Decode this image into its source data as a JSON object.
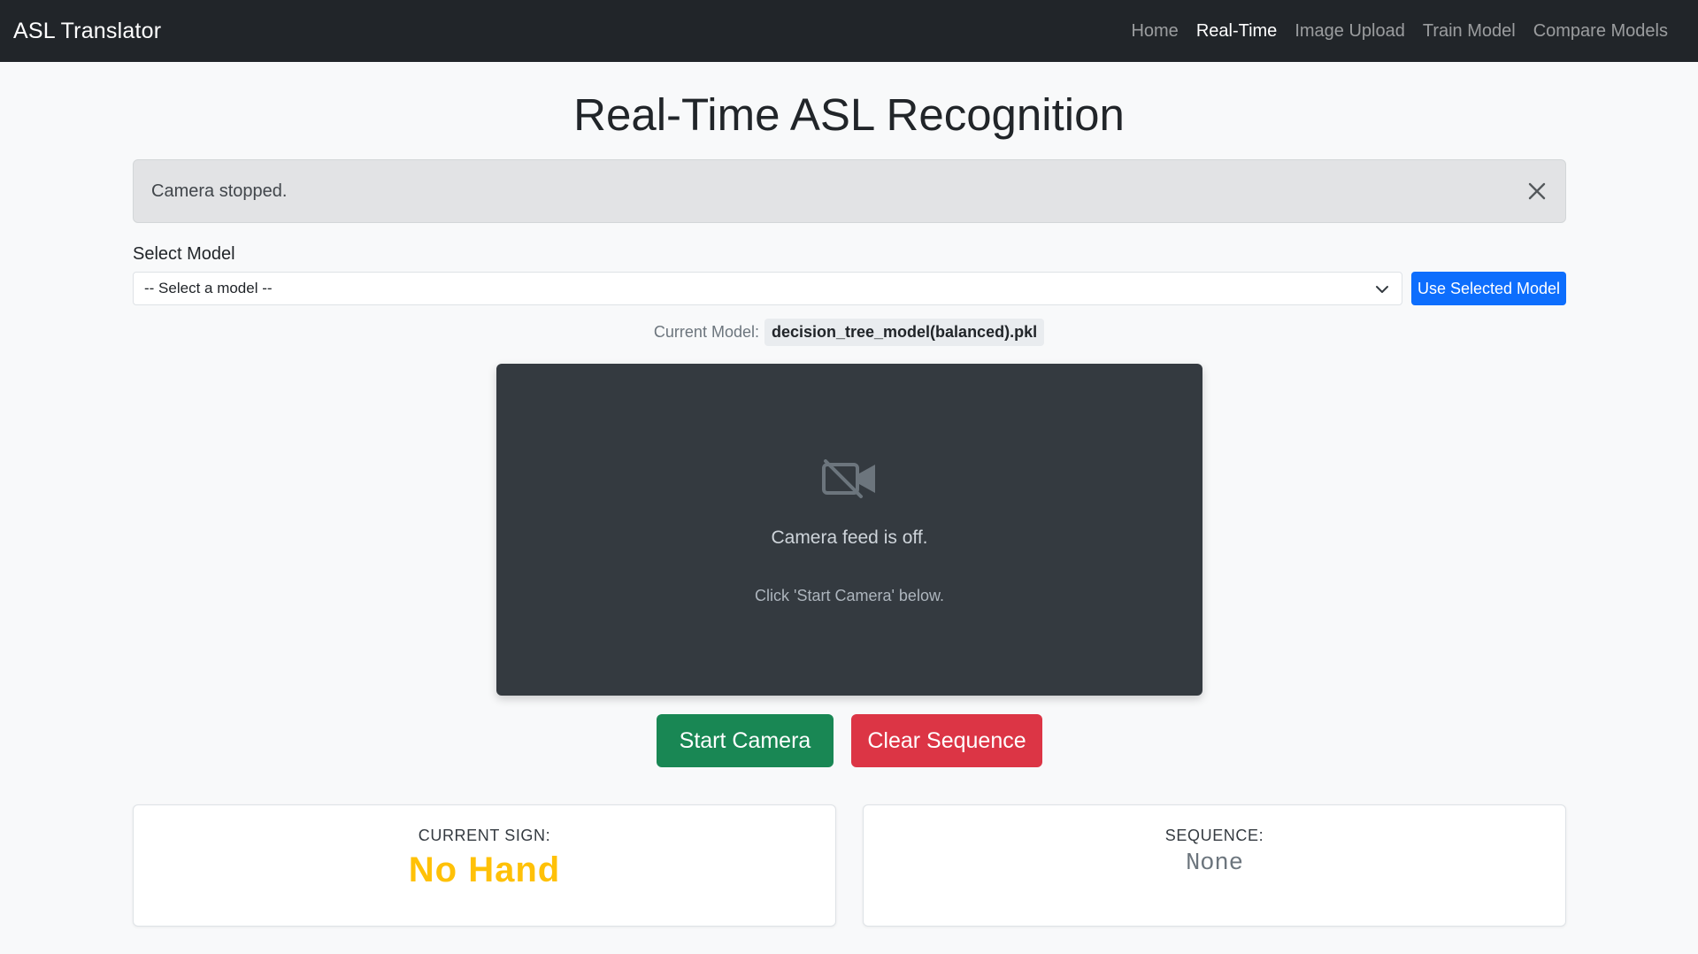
{
  "navbar": {
    "brand": "ASL Translator",
    "links": [
      {
        "label": "Home",
        "active": false
      },
      {
        "label": "Real-Time",
        "active": true
      },
      {
        "label": "Image Upload",
        "active": false
      },
      {
        "label": "Train Model",
        "active": false
      },
      {
        "label": "Compare Models",
        "active": false
      }
    ]
  },
  "page": {
    "title": "Real-Time ASL Recognition"
  },
  "alert": {
    "message": "Camera stopped.",
    "close_icon": "close-icon"
  },
  "model": {
    "select_label": "Select Model",
    "selected_option": "-- Select a model --",
    "use_button": "Use Selected Model",
    "current_label": "Current Model:",
    "current_value": "decision_tree_model(balanced).pkl"
  },
  "camera": {
    "icon": "camera-off-icon",
    "message": "Camera feed is off.",
    "hint": "Click 'Start Camera' below."
  },
  "controls": {
    "start_label": "Start Camera",
    "clear_label": "Clear Sequence"
  },
  "results": {
    "current_sign_label": "CURRENT SIGN:",
    "current_sign_value": "No Hand",
    "sequence_label": "SEQUENCE:",
    "sequence_value": "None"
  },
  "colors": {
    "navbar_bg": "#212529",
    "primary": "#0d6efd",
    "success": "#198754",
    "danger": "#dc3545",
    "warning": "#ffc107",
    "camera_bg": "#343a40"
  }
}
